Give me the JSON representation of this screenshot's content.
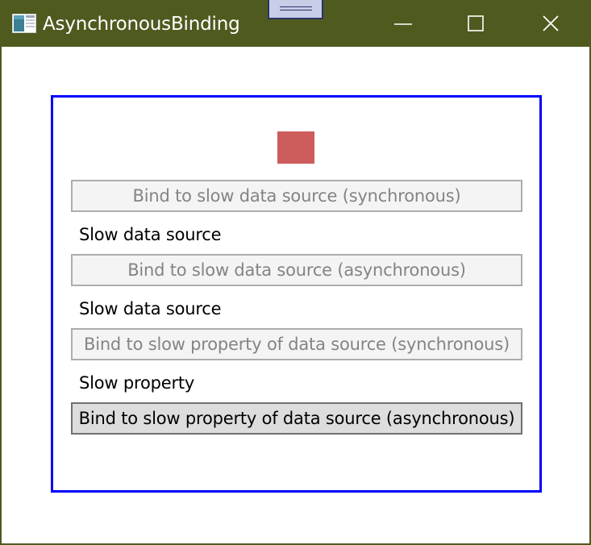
{
  "window": {
    "title": "AsynchronousBinding",
    "icon": "app-window-icon",
    "title_bar_color": "#4f5a1f",
    "controls": [
      "minimize-icon",
      "maximize-icon",
      "close-icon"
    ]
  },
  "panel": {
    "border_color": "#0000ff",
    "indicator_color": "#cd5c5c",
    "buttons": [
      {
        "label": "Bind to slow data source (synchronous)",
        "enabled": false
      },
      {
        "label": "Bind to slow data source (asynchronous)",
        "enabled": false
      },
      {
        "label": "Bind to slow property of data source (synchronous)",
        "enabled": false
      },
      {
        "label": "Bind to slow property of data source (asynchronous)",
        "enabled": true
      }
    ],
    "results": [
      "Slow data source",
      "Slow data source",
      "Slow property"
    ]
  }
}
